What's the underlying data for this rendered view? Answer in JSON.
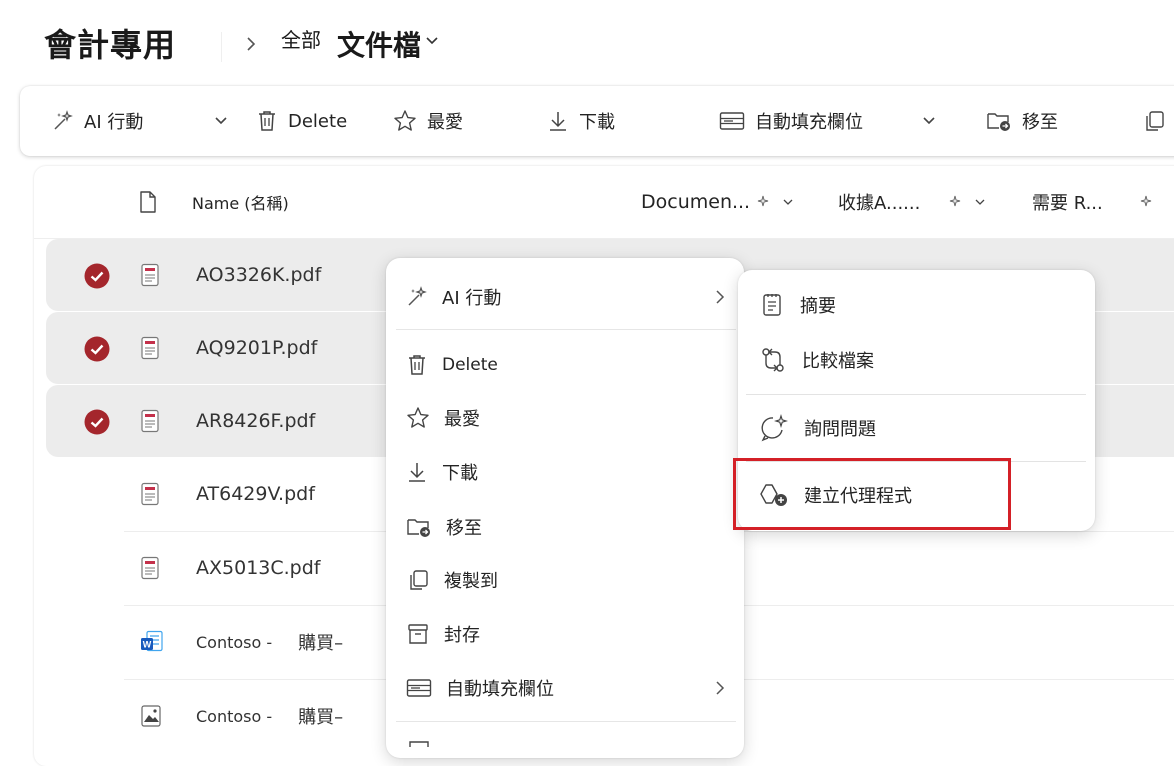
{
  "header": {
    "site_title": "會計專用",
    "breadcrumb_all": "全部",
    "library": "文件檔"
  },
  "toolbar": {
    "ai_actions": "AI 行動",
    "delete": "Delete",
    "favorite": "最愛",
    "download": "下載",
    "autofill": "自動填充欄位",
    "move_to": "移至"
  },
  "columns": {
    "name": "Name (名稱)",
    "document": "Documen...",
    "receipt": "收據A......",
    "requires": "需要 R..."
  },
  "files": [
    {
      "name": "AO3326K.pdf",
      "selected": true,
      "type": "pdf-icon"
    },
    {
      "name": "AQ9201P.pdf",
      "selected": true,
      "type": "pdf-icon"
    },
    {
      "name": "AR8426F.pdf",
      "selected": true,
      "type": "pdf-icon"
    },
    {
      "name": "AT6429V.pdf",
      "selected": false,
      "type": "pdf-icon"
    },
    {
      "name": "AX5013C.pdf",
      "selected": false,
      "type": "pdf-icon"
    },
    {
      "name_a": "Contoso -",
      "name_b": "購買–",
      "selected": false,
      "type": "word-icon"
    },
    {
      "name_a": "Contoso -",
      "name_b": "購買–",
      "selected": false,
      "type": "image-icon"
    }
  ],
  "context_menu": {
    "ai_actions": "AI 行動",
    "delete": "Delete",
    "favorite": "最愛",
    "download": "下載",
    "move_to": "移至",
    "copy_to": "複製到",
    "archive": "封存",
    "autofill": "自動填充欄位"
  },
  "ai_submenu": {
    "summary": "摘要",
    "compare": "比較檔案",
    "ask": "詢問問題",
    "create_agent": "建立代理程式"
  },
  "colors": {
    "check": "#a4262c",
    "highlight": "#d42027",
    "selected_row": "#ececec",
    "pdf": "#c4314b",
    "word": "#185abd"
  }
}
